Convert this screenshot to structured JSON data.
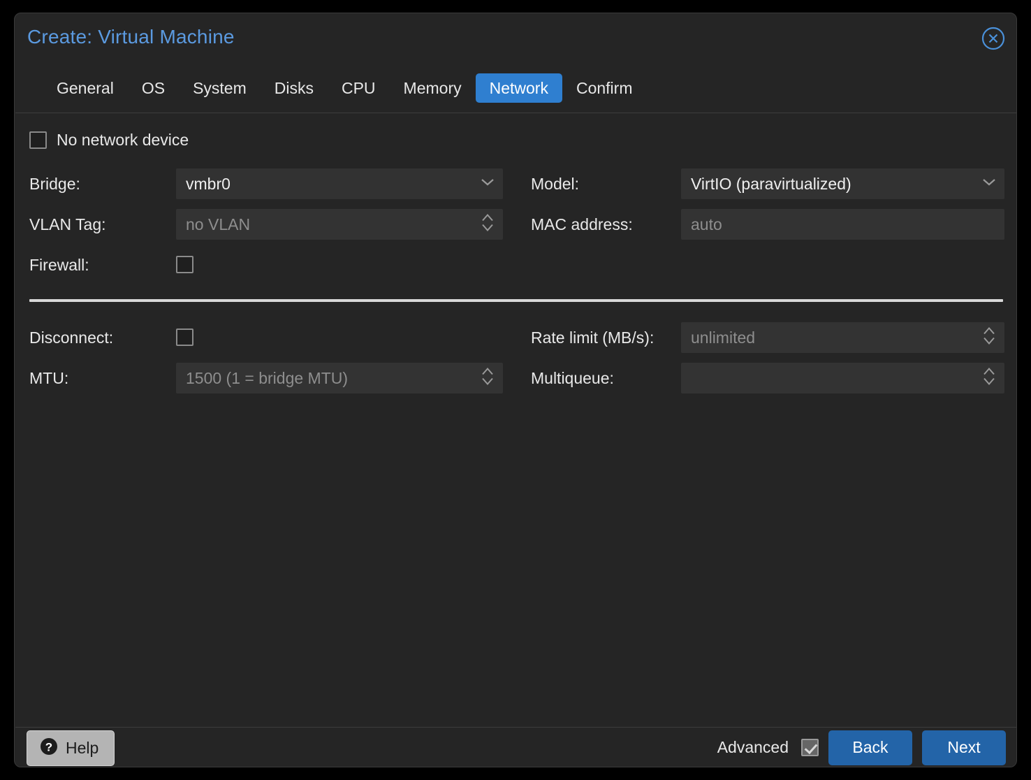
{
  "dialog": {
    "title": "Create: Virtual Machine",
    "close_icon": "close-circle-icon"
  },
  "tabs": [
    {
      "label": "General",
      "active": false
    },
    {
      "label": "OS",
      "active": false
    },
    {
      "label": "System",
      "active": false
    },
    {
      "label": "Disks",
      "active": false
    },
    {
      "label": "CPU",
      "active": false
    },
    {
      "label": "Memory",
      "active": false
    },
    {
      "label": "Network",
      "active": true
    },
    {
      "label": "Confirm",
      "active": false
    }
  ],
  "form": {
    "no_network_device": {
      "label": "No network device",
      "checked": false
    },
    "basic": {
      "bridge": {
        "label": "Bridge:",
        "value": "vmbr0",
        "placeholder": "",
        "icon": "chevron-down-icon"
      },
      "vlan_tag": {
        "label": "VLAN Tag:",
        "value": "",
        "placeholder": "no VLAN",
        "icon": "spinner-updown-icon"
      },
      "firewall": {
        "label": "Firewall:",
        "checked": false
      },
      "model": {
        "label": "Model:",
        "value": "VirtIO (paravirtualized)",
        "placeholder": "",
        "icon": "chevron-down-icon"
      },
      "mac_address": {
        "label": "MAC address:",
        "value": "",
        "placeholder": "auto"
      }
    },
    "advanced_section": {
      "disconnect": {
        "label": "Disconnect:",
        "checked": false
      },
      "mtu": {
        "label": "MTU:",
        "value": "",
        "placeholder": "1500 (1 = bridge MTU)",
        "icon": "spinner-updown-icon"
      },
      "rate_limit": {
        "label": "Rate limit (MB/s):",
        "value": "",
        "placeholder": "unlimited",
        "icon": "spinner-updown-icon"
      },
      "multiqueue": {
        "label": "Multiqueue:",
        "value": "",
        "placeholder": "",
        "icon": "spinner-updown-icon"
      }
    }
  },
  "footer": {
    "help_label": "Help",
    "help_icon": "question-circle-icon",
    "advanced_label": "Advanced",
    "advanced_checked": true,
    "back_label": "Back",
    "next_label": "Next"
  },
  "colors": {
    "accent_blue": "#5b9ae0",
    "tab_active_blue": "#2f7fd0",
    "button_blue": "#2364a8",
    "dialog_bg": "#252525",
    "field_bg": "#2e2e2e",
    "page_bg": "#000000"
  }
}
